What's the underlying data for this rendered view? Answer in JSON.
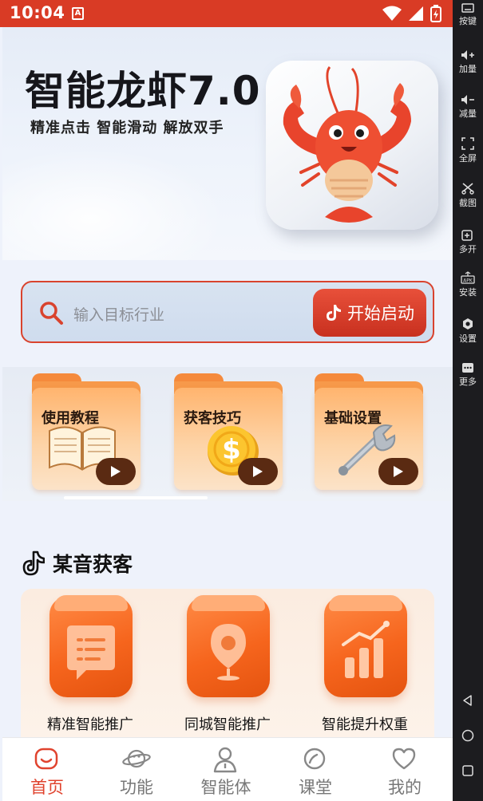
{
  "status_bar": {
    "time": "10:04",
    "notif_glyph": "A"
  },
  "banner": {
    "title": "智能龙虾7.0",
    "subtitle": "精准点击 智能滑动 解放双手"
  },
  "search": {
    "placeholder": "输入目标行业",
    "start_label": "开始启动"
  },
  "cards": [
    {
      "label": "使用教程",
      "icon": "book-icon"
    },
    {
      "label": "获客技巧",
      "icon": "dollar-coin-icon"
    },
    {
      "label": "基础设置",
      "icon": "wrench-icon"
    }
  ],
  "section": {
    "title": "某音获客"
  },
  "features": [
    {
      "label": "精准智能推广",
      "icon": "chat-list-icon"
    },
    {
      "label": "同城智能推广",
      "icon": "location-pin-icon"
    },
    {
      "label": "智能提升权重",
      "icon": "bar-chart-icon"
    }
  ],
  "bottom_nav": [
    {
      "label": "首页",
      "active": true
    },
    {
      "label": "功能",
      "active": false
    },
    {
      "label": "智能体",
      "active": false
    },
    {
      "label": "课堂",
      "active": false
    },
    {
      "label": "我的",
      "active": false
    }
  ],
  "emulator_sidebar": [
    {
      "label": "按键"
    },
    {
      "label": "加量"
    },
    {
      "label": "减量"
    },
    {
      "label": "全屏"
    },
    {
      "label": "截图"
    },
    {
      "label": "多开"
    },
    {
      "label": "安装"
    },
    {
      "label": "设置"
    },
    {
      "label": "更多"
    }
  ],
  "colors": {
    "accent": "#d93b25",
    "orange": "#f6651d",
    "nav_active": "#e0432e"
  }
}
